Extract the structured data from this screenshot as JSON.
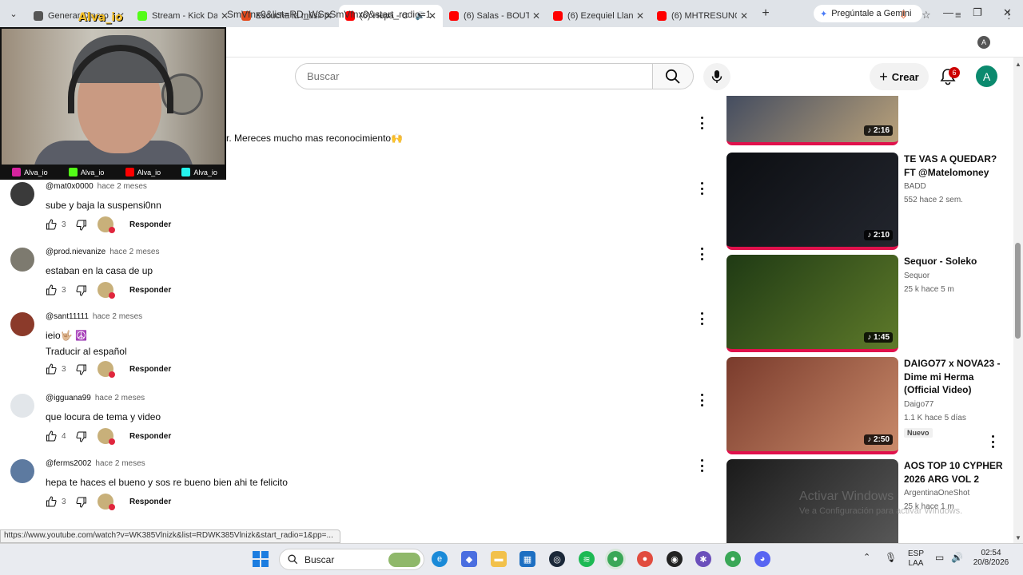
{
  "browser": {
    "tabs": [
      {
        "label": "Generar Dinero",
        "favicon": "web-icon",
        "color": "#555555",
        "active": false
      },
      {
        "label": "Stream - Kick Da",
        "favicon": "kick-icon",
        "color": "#53fc18",
        "active": false
      },
      {
        "label": "Escucha la músic",
        "favicon": "soundcloud-icon",
        "color": "#e34a1c",
        "active": false
      },
      {
        "label": "(6) Hepa - C",
        "favicon": "youtube-icon",
        "color": "#ff0000",
        "active": true
      },
      {
        "label": "(6) Salas - BOUT",
        "favicon": "youtube-icon",
        "color": "#ff0000",
        "active": false
      },
      {
        "label": "(6) Ezequiel Llan",
        "favicon": "youtube-icon",
        "color": "#ff0000",
        "active": false
      },
      {
        "label": "(6) MHTRESUNO",
        "favicon": "youtube-icon",
        "color": "#ff0000",
        "active": false
      }
    ],
    "gemini_label": "Pregúntale a Gemini",
    "url": "SmVfnx0&list=RD_WSpSmVfnx0&start_radio=1",
    "profile_letter": "A"
  },
  "youtube": {
    "search_placeholder": "Buscar",
    "create_label": "Crear",
    "notification_count": "6",
    "user_initial": "A"
  },
  "stream_overlay": {
    "streamer_name": "Alva_io",
    "socials": [
      {
        "platform": "instagram-icon",
        "handle": "Alva_io",
        "color": "#d6249f"
      },
      {
        "platform": "kick-icon",
        "handle": "Alva_io",
        "color": "#53fc18"
      },
      {
        "platform": "youtube-icon",
        "handle": "Alva_io",
        "color": "#ff0000"
      },
      {
        "platform": "tiktok-icon",
        "handle": "Alva_io",
        "color": "#25f4ee"
      }
    ]
  },
  "top_comment_fragment": "r. Mereces mucho mas reconocimiento🙌",
  "comments": [
    {
      "author": "@mat0x0000",
      "time": "hace 2 meses",
      "text": "sube y baja la suspensi0nn",
      "likes": "3",
      "reply_label": "Responder",
      "avatar_color": "#3a3a3a"
    },
    {
      "author": "@prod.nievanize",
      "time": "hace 2 meses",
      "text": "estaban en la casa de up",
      "likes": "3",
      "reply_label": "Responder",
      "avatar_color": "#7d7a6f"
    },
    {
      "author": "@sant11111",
      "time": "hace 2 meses",
      "text": "ieio🤟🏼 ☮️\nTraducir al español",
      "likes": "3",
      "reply_label": "Responder",
      "avatar_color": "#8b3a2a"
    },
    {
      "author": "@igguana99",
      "time": "hace 2 meses",
      "text": "que locura de tema y video",
      "likes": "4",
      "reply_label": "Responder",
      "avatar_color": "#e2e6ea"
    },
    {
      "author": "@ferms2002",
      "time": "hace 2 meses",
      "text": "hepa te haces el bueno y sos re bueno bien ahi te felicito",
      "likes": "3",
      "reply_label": "Responder",
      "avatar_color": "#5d7aa0"
    }
  ],
  "recommendations": [
    {
      "title": "",
      "channel": "",
      "meta": "",
      "duration": "2:16",
      "thumb_colors": [
        "#2a3a5a",
        "#b9a17a"
      ]
    },
    {
      "title": "TE VAS A QUEDAR?  FT @Matelomoney",
      "channel": "BADD",
      "meta": "552  hace 2 sem.",
      "duration": "2:10",
      "thumb_colors": [
        "#0c0e12",
        "#23262e"
      ]
    },
    {
      "title": "Sequor - Soleko",
      "channel": "Sequor",
      "meta": "25 k  hace 5 m",
      "duration": "1:45",
      "thumb_colors": [
        "#1f3a14",
        "#5e7a2a"
      ]
    },
    {
      "title": "DAIGO77 x NOVA23 - Dime mi Herma (Official Video)",
      "channel": "Daigo77",
      "meta": "1.1 K  hace 5 días",
      "badge": "Nuevo",
      "duration": "2:50",
      "thumb_colors": [
        "#7a3b2c",
        "#c98a6a"
      ]
    },
    {
      "title": "AOS TOP 10 CYPHER 2026 ARG VOL 2",
      "channel": "ArgentinaOneShot",
      "meta": "25 k  hace 1 m",
      "duration": "",
      "thumb_colors": [
        "#1a1a1a",
        "#5a5a5a"
      ]
    }
  ],
  "status_url": "https://www.youtube.com/watch?v=WK385Vlnizk&list=RDWK385Vlnizk&start_radio=1&pp=...",
  "watermark": {
    "title": "Activar Windows",
    "subtitle": "Ve a Configuración para activar Windows."
  },
  "taskbar": {
    "search_label": "Buscar",
    "language": "ESP",
    "language_sub": "LAA",
    "time": "02:54",
    "date": "20/8/2026"
  }
}
